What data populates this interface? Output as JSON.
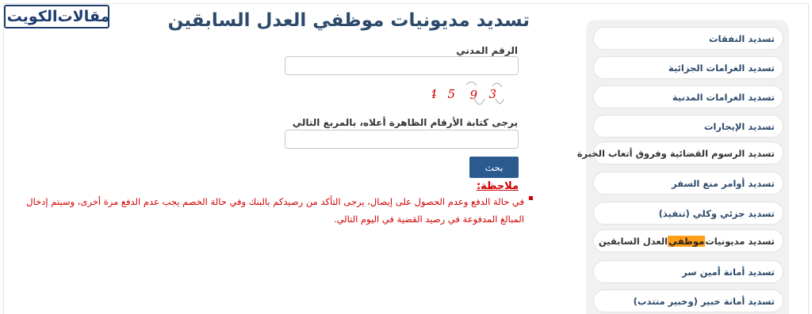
{
  "logo": {
    "part1": "مقالات",
    "part2": "الكويت"
  },
  "page": {
    "title": "تسديد مديونيات موظفي العدل السابقين"
  },
  "form": {
    "civil_id_label": "الرقم المدني",
    "civil_id_value": "",
    "captcha_digits": [
      "4",
      "5",
      "9",
      "3"
    ],
    "captcha_label": "يرجى كتابة الأرقام الظاهرة أعلاه، بالمربع التالي",
    "captcha_value": "",
    "search_button": "بحث"
  },
  "note": {
    "title": "ملاحظة:",
    "text": "في حالة الدفع وعدم الحصول على إيصال، يرجى التأكد من رصيدكم بالبنك وفي حالة الخصم يجب عدم الدفع مرة أخرى، وسيتم إدخال المبالغ المدفوعة في رصيد القضية في اليوم التالي."
  },
  "sidebar": {
    "items": [
      {
        "label": "تسديد النفقات"
      },
      {
        "label": "تسديد الغرامات الجزائية"
      },
      {
        "label": "تسديد الغرامات المدنية"
      },
      {
        "label": "تسديد الإيجارات"
      },
      {
        "label": "تسديد الرسوم القضائية وفروق أتعاب الخبرة"
      },
      {
        "label": "تسديد أوامر منع السفر"
      },
      {
        "label": "تسديد جزئي وكلي (تنفيذ)"
      },
      {
        "label_before": "تسديد مديونيات ",
        "label_highlight": "موظفي",
        "label_after": " العدل السابقين"
      },
      {
        "label": "تسديد أمانة أمين سر"
      },
      {
        "label": "تسديد أمانة خبير (وخبير منتدب)"
      }
    ]
  },
  "colors": {
    "accent": "#2b5a8f",
    "title": "#2c4a6b",
    "note": "#d20000",
    "highlight": "#ff9f1a",
    "captcha": "#d20000"
  }
}
